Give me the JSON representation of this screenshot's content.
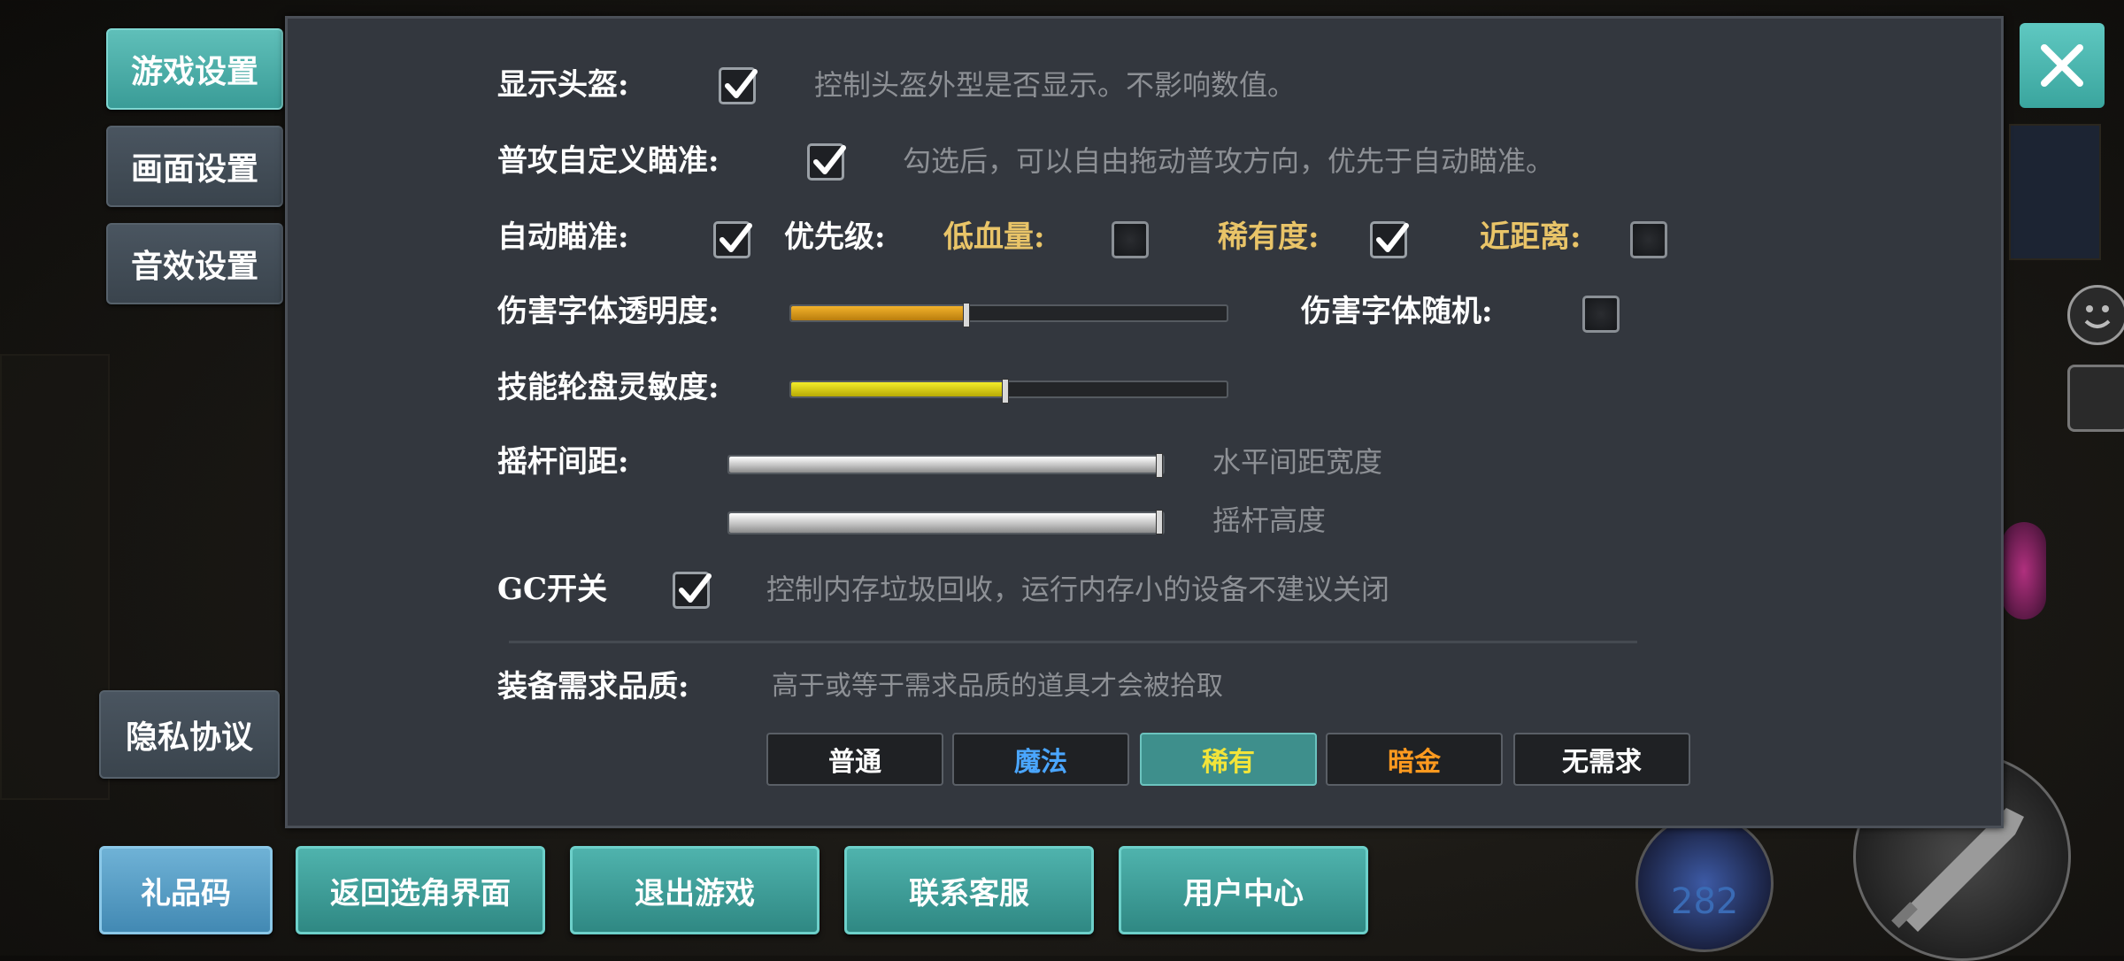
{
  "sidebar": {
    "tabs": [
      {
        "label": "游戏设置",
        "active": true
      },
      {
        "label": "画面设置",
        "active": false
      },
      {
        "label": "音效设置",
        "active": false
      }
    ],
    "privacy_label": "隐私协议"
  },
  "settings": {
    "helmet": {
      "label": "显示头盔:",
      "checked": true,
      "hint": "控制头盔外型是否显示。不影响数值。"
    },
    "custom_aim": {
      "label": "普攻自定义瞄准:",
      "checked": true,
      "hint": "勾选后，可以自由拖动普攻方向，优先于自动瞄准。"
    },
    "auto_aim": {
      "label": "自动瞄准:",
      "checked": true,
      "priority_label": "优先级:",
      "low_hp": {
        "label": "低血量:",
        "checked": false
      },
      "rarity": {
        "label": "稀有度:",
        "checked": true
      },
      "near": {
        "label": "近距离:",
        "checked": false
      }
    },
    "damage_opacity": {
      "label": "伤害字体透明度:",
      "value": 0.4
    },
    "damage_random": {
      "label": "伤害字体随机:",
      "checked": false
    },
    "wheel_sensitivity": {
      "label": "技能轮盘灵敏度:",
      "value": 0.49
    },
    "joystick": {
      "label": "摇杆间距:",
      "horizontal": {
        "hint": "水平间距宽度",
        "value": 1.0
      },
      "height": {
        "hint": "摇杆高度",
        "value": 1.0
      }
    },
    "gc": {
      "label": "GC开关",
      "checked": true,
      "hint": "控制内存垃圾回收，运行内存小的设备不建议关闭"
    },
    "quality": {
      "label": "装备需求品质:",
      "hint": "高于或等于需求品质的道具才会被拾取",
      "options": [
        {
          "label": "普通",
          "color": "#ffffff",
          "selected": false
        },
        {
          "label": "魔法",
          "color": "#4aa6ff",
          "selected": false
        },
        {
          "label": "稀有",
          "color": "#f2e43a",
          "selected": true
        },
        {
          "label": "暗金",
          "color": "#ff9a1f",
          "selected": false
        },
        {
          "label": "无需求",
          "color": "#ffffff",
          "selected": false
        }
      ]
    }
  },
  "bottom_buttons": {
    "gift_code": "礼品码",
    "back_to_select": "返回选角界面",
    "exit_game": "退出游戏",
    "contact": "联系客服",
    "user_center": "用户中心"
  },
  "hud": {
    "skill_count": "282"
  },
  "colors": {
    "accent": "#4fb3ad",
    "panel": "#33373e",
    "label_gold": "#e9c468"
  }
}
